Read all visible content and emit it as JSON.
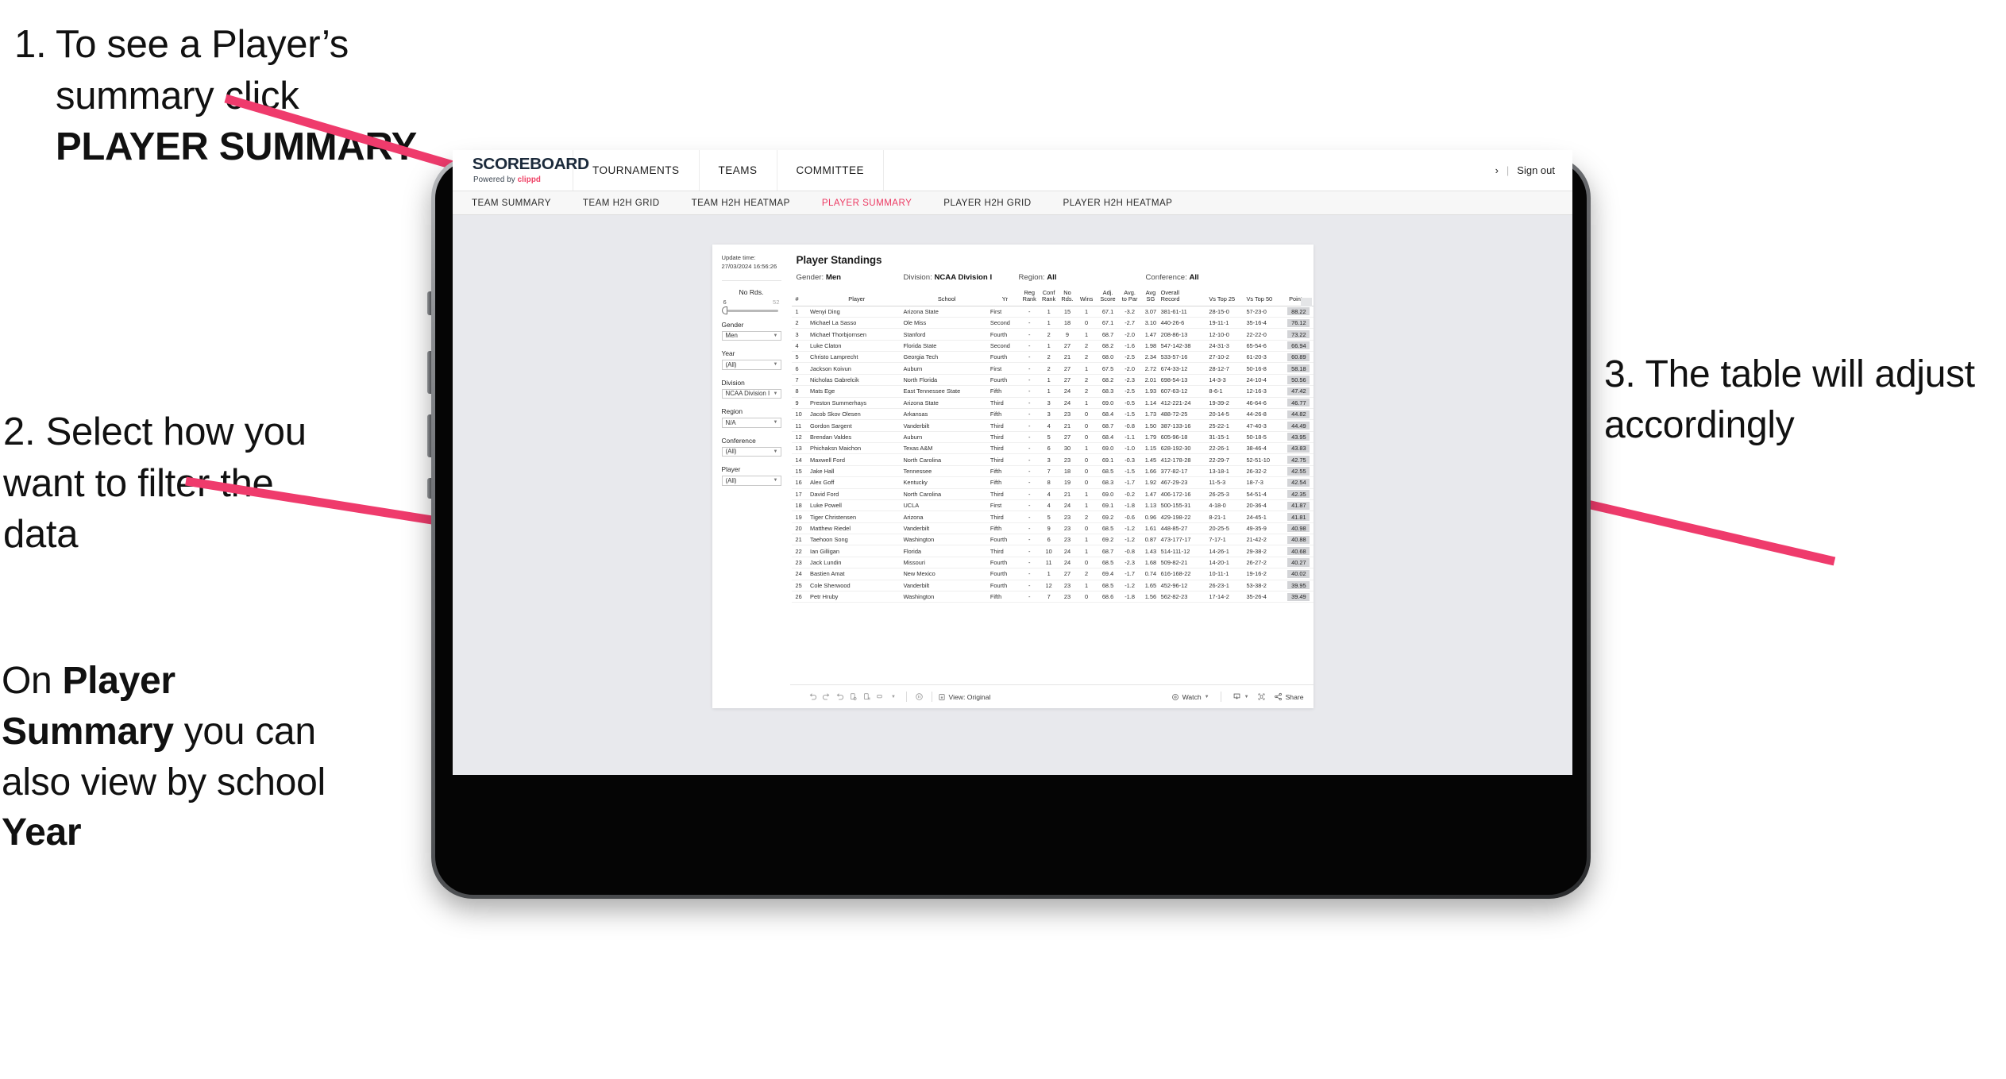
{
  "annotations": [
    {
      "id": "callout-1",
      "number": "1.",
      "text_prefix": "To see a Player’s summary click ",
      "text_bold": "PLAYER SUMMARY"
    },
    {
      "id": "callout-2",
      "text": "2. Select how you want to filter the data"
    },
    {
      "id": "callout-3",
      "prefix": "On ",
      "bold1": "Player Summary",
      "mid": " you can also view by school ",
      "bold2": "Year"
    },
    {
      "id": "callout-4",
      "text": "3. The table will adjust accordingly"
    }
  ],
  "colors": {
    "accent_pink": "#ec3a63",
    "arrow_pink": "#ef3b6c",
    "brand_navy": "#1b2a3b",
    "points_highlight": "#d3d4d7"
  },
  "app": {
    "logo": {
      "main": "SCOREBOARD",
      "sub_prefix": "Powered by ",
      "sub_brand": "clippd"
    },
    "topnav": [
      {
        "label": "TOURNAMENTS"
      },
      {
        "label": "TEAMS"
      },
      {
        "label": "COMMITTEE"
      }
    ],
    "header_right": {
      "chevron": "›",
      "separator": "|",
      "signout": "Sign out"
    },
    "subnav": [
      {
        "label": "TEAM SUMMARY",
        "active": false
      },
      {
        "label": "TEAM H2H GRID",
        "active": false
      },
      {
        "label": "TEAM H2H HEATMAP",
        "active": false
      },
      {
        "label": "PLAYER SUMMARY",
        "active": true
      },
      {
        "label": "PLAYER H2H GRID",
        "active": false
      },
      {
        "label": "PLAYER H2H HEATMAP",
        "active": false
      }
    ]
  },
  "sidebar": {
    "update_label": "Update time:",
    "update_value": "27/03/2024 16:56:26",
    "slider": {
      "title": "No Rds.",
      "min": "6",
      "max": "52"
    },
    "filters": [
      {
        "label": "Gender",
        "value": "Men"
      },
      {
        "label": "Year",
        "value": "(All)"
      },
      {
        "label": "Division",
        "value": "NCAA Division I"
      },
      {
        "label": "Region",
        "value": "N/A"
      },
      {
        "label": "Conference",
        "value": "(All)"
      },
      {
        "label": "Player",
        "value": "(All)"
      }
    ]
  },
  "viz": {
    "title": "Player Standings",
    "summary": [
      {
        "label": "Gender:",
        "value": "Men"
      },
      {
        "label": "Division:",
        "value": "NCAA Division I"
      },
      {
        "label": "Region:",
        "value": "All"
      },
      {
        "label": "Conference:",
        "value": "All"
      }
    ],
    "columns": [
      {
        "l1": "#",
        "l2": ""
      },
      {
        "l1": "Player",
        "l2": ""
      },
      {
        "l1": "School",
        "l2": ""
      },
      {
        "l1": "Yr",
        "l2": ""
      },
      {
        "l1": "Reg",
        "l2": "Rank"
      },
      {
        "l1": "Conf",
        "l2": "Rank"
      },
      {
        "l1": "No",
        "l2": "Rds."
      },
      {
        "l1": "Wins",
        "l2": ""
      },
      {
        "l1": "Adj.",
        "l2": "Score"
      },
      {
        "l1": "Avg.",
        "l2": "to Par"
      },
      {
        "l1": "Avg",
        "l2": "SG"
      },
      {
        "l1": "Overall",
        "l2": "Record"
      },
      {
        "l1": "Vs Top 25",
        "l2": ""
      },
      {
        "l1": "Vs Top 50",
        "l2": ""
      },
      {
        "l1": "Points",
        "l2": ""
      }
    ],
    "rows": [
      {
        "n": "1",
        "player": "Wenyi Ding",
        "school": "Arizona State",
        "yr": "First",
        "reg": "-",
        "conf": "1",
        "rds": "15",
        "wins": "1",
        "adj": "67.1",
        "par": "-3.2",
        "sg": "3.07",
        "rec": "381-61-11",
        "t25": "28-15-0",
        "t50": "57-23-0",
        "pts": "88.22"
      },
      {
        "n": "2",
        "player": "Michael La Sasso",
        "school": "Ole Miss",
        "yr": "Second",
        "reg": "-",
        "conf": "1",
        "rds": "18",
        "wins": "0",
        "adj": "67.1",
        "par": "-2.7",
        "sg": "3.10",
        "rec": "440-26-6",
        "t25": "19-11-1",
        "t50": "35-16-4",
        "pts": "76.12"
      },
      {
        "n": "3",
        "player": "Michael Thorbjornsen",
        "school": "Stanford",
        "yr": "Fourth",
        "reg": "-",
        "conf": "2",
        "rds": "9",
        "wins": "1",
        "adj": "68.7",
        "par": "-2.0",
        "sg": "1.47",
        "rec": "208-86-13",
        "t25": "12-10-0",
        "t50": "22-22-0",
        "pts": "73.22"
      },
      {
        "n": "4",
        "player": "Luke Claton",
        "school": "Florida State",
        "yr": "Second",
        "reg": "-",
        "conf": "1",
        "rds": "27",
        "wins": "2",
        "adj": "68.2",
        "par": "-1.6",
        "sg": "1.98",
        "rec": "547-142-38",
        "t25": "24-31-3",
        "t50": "65-54-6",
        "pts": "66.94"
      },
      {
        "n": "5",
        "player": "Christo Lamprecht",
        "school": "Georgia Tech",
        "yr": "Fourth",
        "reg": "-",
        "conf": "2",
        "rds": "21",
        "wins": "2",
        "adj": "68.0",
        "par": "-2.5",
        "sg": "2.34",
        "rec": "533-57-16",
        "t25": "27-10-2",
        "t50": "61-20-3",
        "pts": "60.89"
      },
      {
        "n": "6",
        "player": "Jackson Koivun",
        "school": "Auburn",
        "yr": "First",
        "reg": "-",
        "conf": "2",
        "rds": "27",
        "wins": "1",
        "adj": "67.5",
        "par": "-2.0",
        "sg": "2.72",
        "rec": "674-33-12",
        "t25": "28-12-7",
        "t50": "50-16-8",
        "pts": "58.18"
      },
      {
        "n": "7",
        "player": "Nicholas Gabrelcik",
        "school": "North Florida",
        "yr": "Fourth",
        "reg": "-",
        "conf": "1",
        "rds": "27",
        "wins": "2",
        "adj": "68.2",
        "par": "-2.3",
        "sg": "2.01",
        "rec": "698-54-13",
        "t25": "14-3-3",
        "t50": "24-10-4",
        "pts": "50.56"
      },
      {
        "n": "8",
        "player": "Mats Ege",
        "school": "East Tennessee State",
        "yr": "Fifth",
        "reg": "-",
        "conf": "1",
        "rds": "24",
        "wins": "2",
        "adj": "68.3",
        "par": "-2.5",
        "sg": "1.93",
        "rec": "607-63-12",
        "t25": "8-6-1",
        "t50": "12-16-3",
        "pts": "47.42"
      },
      {
        "n": "9",
        "player": "Preston Summerhays",
        "school": "Arizona State",
        "yr": "Third",
        "reg": "-",
        "conf": "3",
        "rds": "24",
        "wins": "1",
        "adj": "69.0",
        "par": "-0.5",
        "sg": "1.14",
        "rec": "412-221-24",
        "t25": "19-39-2",
        "t50": "46-64-6",
        "pts": "46.77"
      },
      {
        "n": "10",
        "player": "Jacob Skov Olesen",
        "school": "Arkansas",
        "yr": "Fifth",
        "reg": "-",
        "conf": "3",
        "rds": "23",
        "wins": "0",
        "adj": "68.4",
        "par": "-1.5",
        "sg": "1.73",
        "rec": "488-72-25",
        "t25": "20-14-5",
        "t50": "44-26-8",
        "pts": "44.82"
      },
      {
        "n": "11",
        "player": "Gordon Sargent",
        "school": "Vanderbilt",
        "yr": "Third",
        "reg": "-",
        "conf": "4",
        "rds": "21",
        "wins": "0",
        "adj": "68.7",
        "par": "-0.8",
        "sg": "1.50",
        "rec": "387-133-16",
        "t25": "25-22-1",
        "t50": "47-40-3",
        "pts": "44.49"
      },
      {
        "n": "12",
        "player": "Brendan Valdes",
        "school": "Auburn",
        "yr": "Third",
        "reg": "-",
        "conf": "5",
        "rds": "27",
        "wins": "0",
        "adj": "68.4",
        "par": "-1.1",
        "sg": "1.79",
        "rec": "605-96-18",
        "t25": "31-15-1",
        "t50": "50-18-5",
        "pts": "43.95"
      },
      {
        "n": "13",
        "player": "Phichaksn Maichon",
        "school": "Texas A&M",
        "yr": "Third",
        "reg": "-",
        "conf": "6",
        "rds": "30",
        "wins": "1",
        "adj": "69.0",
        "par": "-1.0",
        "sg": "1.15",
        "rec": "628-192-30",
        "t25": "22-26-1",
        "t50": "38-46-4",
        "pts": "43.83"
      },
      {
        "n": "14",
        "player": "Maxwell Ford",
        "school": "North Carolina",
        "yr": "Third",
        "reg": "-",
        "conf": "3",
        "rds": "23",
        "wins": "0",
        "adj": "69.1",
        "par": "-0.3",
        "sg": "1.45",
        "rec": "412-178-28",
        "t25": "22-29-7",
        "t50": "52-51-10",
        "pts": "42.75"
      },
      {
        "n": "15",
        "player": "Jake Hall",
        "school": "Tennessee",
        "yr": "Fifth",
        "reg": "-",
        "conf": "7",
        "rds": "18",
        "wins": "0",
        "adj": "68.5",
        "par": "-1.5",
        "sg": "1.66",
        "rec": "377-82-17",
        "t25": "13-18-1",
        "t50": "26-32-2",
        "pts": "42.55"
      },
      {
        "n": "16",
        "player": "Alex Goff",
        "school": "Kentucky",
        "yr": "Fifth",
        "reg": "-",
        "conf": "8",
        "rds": "19",
        "wins": "0",
        "adj": "68.3",
        "par": "-1.7",
        "sg": "1.92",
        "rec": "467-29-23",
        "t25": "11-5-3",
        "t50": "18-7-3",
        "pts": "42.54"
      },
      {
        "n": "17",
        "player": "David Ford",
        "school": "North Carolina",
        "yr": "Third",
        "reg": "-",
        "conf": "4",
        "rds": "21",
        "wins": "1",
        "adj": "69.0",
        "par": "-0.2",
        "sg": "1.47",
        "rec": "406-172-16",
        "t25": "26-25-3",
        "t50": "54-51-4",
        "pts": "42.35"
      },
      {
        "n": "18",
        "player": "Luke Powell",
        "school": "UCLA",
        "yr": "First",
        "reg": "-",
        "conf": "4",
        "rds": "24",
        "wins": "1",
        "adj": "69.1",
        "par": "-1.8",
        "sg": "1.13",
        "rec": "500-155-31",
        "t25": "4-18-0",
        "t50": "20-36-4",
        "pts": "41.87"
      },
      {
        "n": "19",
        "player": "Tiger Christensen",
        "school": "Arizona",
        "yr": "Third",
        "reg": "-",
        "conf": "5",
        "rds": "23",
        "wins": "2",
        "adj": "69.2",
        "par": "-0.6",
        "sg": "0.96",
        "rec": "429-198-22",
        "t25": "8-21-1",
        "t50": "24-45-1",
        "pts": "41.81"
      },
      {
        "n": "20",
        "player": "Matthew Riedel",
        "school": "Vanderbilt",
        "yr": "Fifth",
        "reg": "-",
        "conf": "9",
        "rds": "23",
        "wins": "0",
        "adj": "68.5",
        "par": "-1.2",
        "sg": "1.61",
        "rec": "448-85-27",
        "t25": "20-25-5",
        "t50": "49-35-9",
        "pts": "40.98"
      },
      {
        "n": "21",
        "player": "Taehoon Song",
        "school": "Washington",
        "yr": "Fourth",
        "reg": "-",
        "conf": "6",
        "rds": "23",
        "wins": "1",
        "adj": "69.2",
        "par": "-1.2",
        "sg": "0.87",
        "rec": "473-177-17",
        "t25": "7-17-1",
        "t50": "21-42-2",
        "pts": "40.88"
      },
      {
        "n": "22",
        "player": "Ian Gilligan",
        "school": "Florida",
        "yr": "Third",
        "reg": "-",
        "conf": "10",
        "rds": "24",
        "wins": "1",
        "adj": "68.7",
        "par": "-0.8",
        "sg": "1.43",
        "rec": "514-111-12",
        "t25": "14-26-1",
        "t50": "29-38-2",
        "pts": "40.68"
      },
      {
        "n": "23",
        "player": "Jack Lundin",
        "school": "Missouri",
        "yr": "Fourth",
        "reg": "-",
        "conf": "11",
        "rds": "24",
        "wins": "0",
        "adj": "68.5",
        "par": "-2.3",
        "sg": "1.68",
        "rec": "509-82-21",
        "t25": "14-20-1",
        "t50": "26-27-2",
        "pts": "40.27"
      },
      {
        "n": "24",
        "player": "Bastien Amat",
        "school": "New Mexico",
        "yr": "Fourth",
        "reg": "-",
        "conf": "1",
        "rds": "27",
        "wins": "2",
        "adj": "69.4",
        "par": "-1.7",
        "sg": "0.74",
        "rec": "616-168-22",
        "t25": "10-11-1",
        "t50": "19-16-2",
        "pts": "40.02"
      },
      {
        "n": "25",
        "player": "Cole Sherwood",
        "school": "Vanderbilt",
        "yr": "Fourth",
        "reg": "-",
        "conf": "12",
        "rds": "23",
        "wins": "1",
        "adj": "68.5",
        "par": "-1.2",
        "sg": "1.65",
        "rec": "452-96-12",
        "t25": "26-23-1",
        "t50": "53-38-2",
        "pts": "39.95"
      },
      {
        "n": "26",
        "player": "Petr Hruby",
        "school": "Washington",
        "yr": "Fifth",
        "reg": "-",
        "conf": "7",
        "rds": "23",
        "wins": "0",
        "adj": "68.6",
        "par": "-1.8",
        "sg": "1.56",
        "rec": "562-82-23",
        "t25": "17-14-2",
        "t50": "35-26-4",
        "pts": "39.49"
      }
    ]
  },
  "toolbar": {
    "view_label": "View: Original",
    "watch_label": "Watch",
    "share_label": "Share",
    "icons": [
      "undo-icon",
      "redo-icon",
      "revert-icon",
      "refresh-data-icon",
      "pause-icon",
      "highlight-icon",
      "device-layout-icon",
      "export-icon",
      "full-screen-icon",
      "share-icon"
    ]
  }
}
